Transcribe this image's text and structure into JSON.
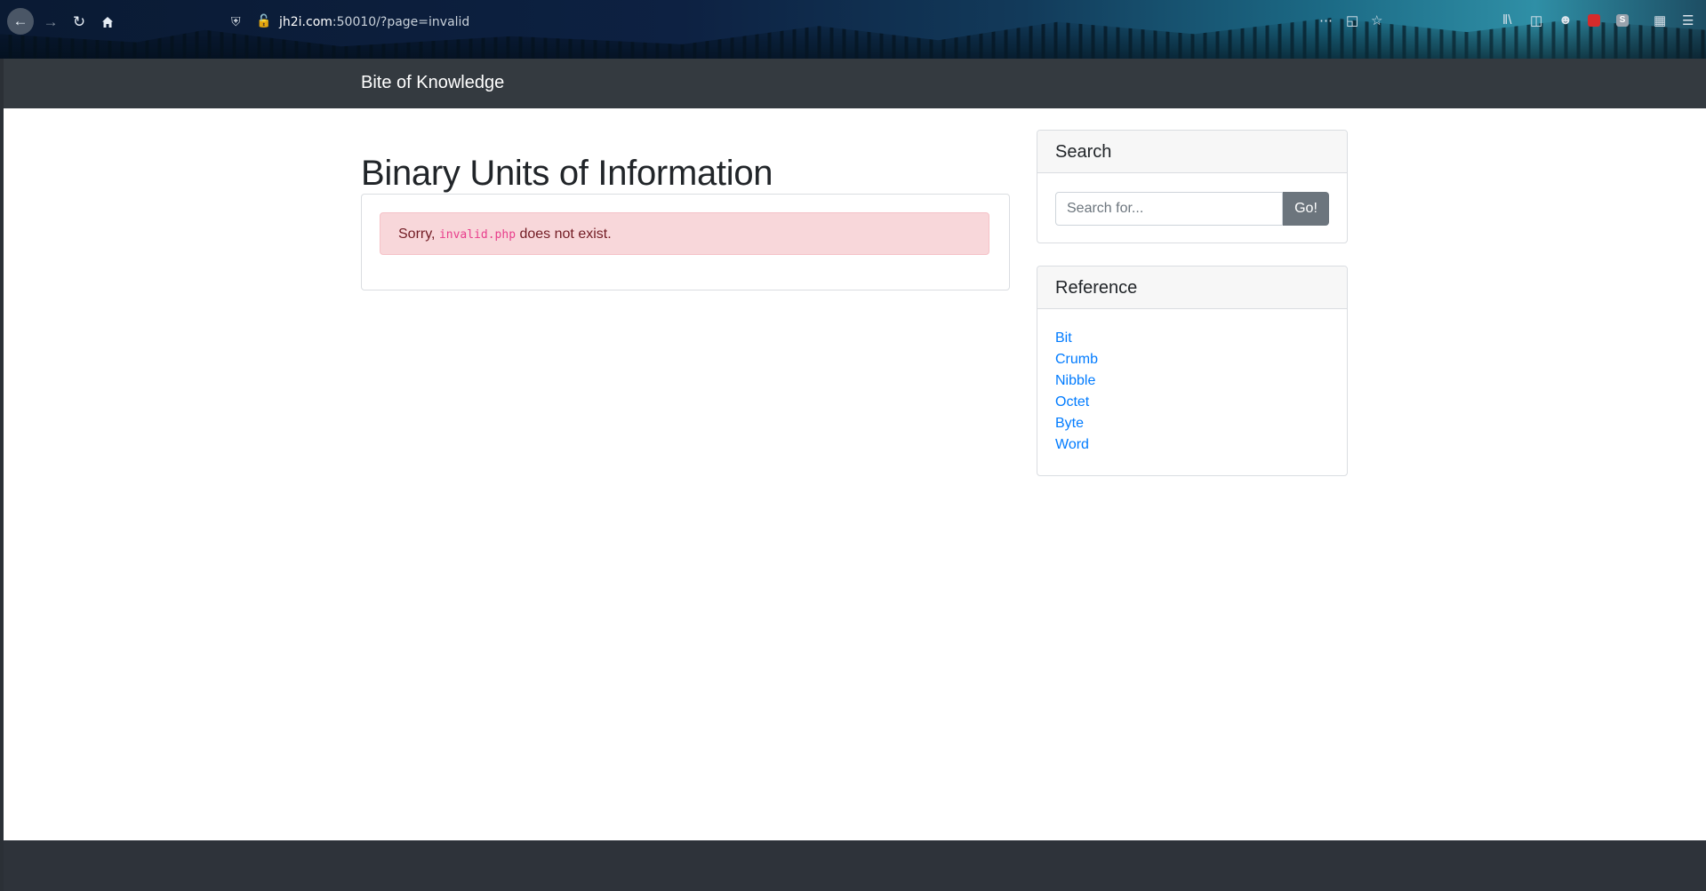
{
  "browser": {
    "url_host": "jh2i.com",
    "url_rest": ":50010/?page=invalid",
    "icons": {
      "back": "back-arrow-icon",
      "forward": "forward-arrow-icon",
      "reload": "reload-icon",
      "home": "home-icon",
      "tracking": "shield-icon",
      "insecure": "insecure-lock-icon",
      "more": "more-dots-icon",
      "pocket": "pocket-icon",
      "bookmark": "star-icon",
      "library": "library-icon",
      "sidebar": "sidebar-icon",
      "account": "account-icon",
      "extension_red": "red-extension-icon",
      "extension_s": "s-extension-icon",
      "extensions": "extensions-icon",
      "menu": "hamburger-menu-icon"
    }
  },
  "navbar": {
    "brand": "Bite of Knowledge"
  },
  "main": {
    "title": "Binary Units of Information",
    "alert": {
      "prefix": "Sorry,",
      "file": "invalid.php",
      "suffix": "does not exist."
    }
  },
  "sidebar": {
    "search": {
      "header": "Search",
      "placeholder": "Search for...",
      "button": "Go!"
    },
    "reference": {
      "header": "Reference",
      "links": [
        "Bit",
        "Crumb",
        "Nibble",
        "Octet",
        "Byte",
        "Word"
      ]
    }
  },
  "colors": {
    "navbar_bg": "#343a40",
    "alert_bg": "#f8d7da",
    "alert_text": "#721c24",
    "link": "#007bff",
    "button_bg": "#6c757d"
  }
}
